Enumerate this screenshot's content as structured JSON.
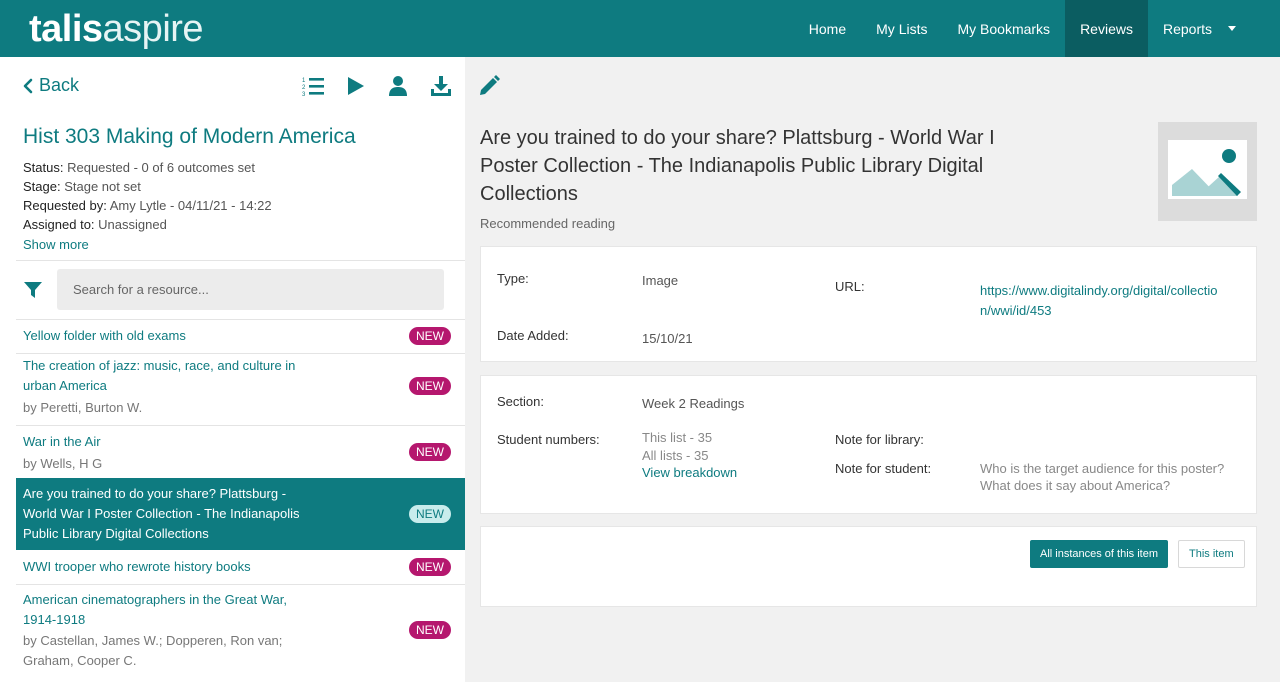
{
  "brand": {
    "logo_bold": "talis",
    "logo_light": "aspire"
  },
  "nav": {
    "items": [
      {
        "label": "Home"
      },
      {
        "label": "My Lists"
      },
      {
        "label": "My Bookmarks"
      },
      {
        "label": "Reviews"
      },
      {
        "label": "Reports"
      }
    ],
    "active": "Reviews"
  },
  "toolbar": {
    "back_label": "Back",
    "icons": [
      "numbered-list-icon",
      "play-icon",
      "user-icon",
      "download-icon",
      "pencil-icon"
    ]
  },
  "list": {
    "title": "Hist 303 Making of Modern America",
    "status_label": "Status:",
    "status_value": "Requested - 0 of 6 outcomes set",
    "stage_label": "Stage:",
    "stage_value": "Stage not set",
    "requested_label": "Requested by:",
    "requested_value": "Amy Lytle - 04/11/21 - 14:22",
    "assigned_label": "Assigned to:",
    "assigned_value": "Unassigned",
    "show_more": "Show more"
  },
  "search": {
    "placeholder": "Search for a resource..."
  },
  "resources": [
    {
      "title": "Yellow folder with old exams",
      "author": "",
      "badge": "NEW"
    },
    {
      "title_lines": [
        "The creation of jazz: music, race, and culture in",
        "urban America"
      ],
      "author": "by Peretti, Burton W.",
      "badge": "NEW"
    },
    {
      "title": "War in the Air",
      "author": "by Wells, H G",
      "badge": "NEW"
    },
    {
      "title_lines": [
        "Are you trained to do your share? Plattsburg -",
        "World War I Poster Collection - The Indianapolis",
        "Public Library Digital Collections"
      ],
      "author": "",
      "badge": "NEW"
    },
    {
      "title": "WWI trooper who rewrote history books",
      "author": "",
      "badge": "NEW"
    },
    {
      "title_lines": [
        "American cinematographers in the Great War,",
        "1914-1918"
      ],
      "author_lines": [
        "by Castellan, James W.; Dopperen, Ron van;",
        "Graham, Cooper C."
      ],
      "badge": "NEW"
    }
  ],
  "detail": {
    "title_lines": [
      "Are you trained to do your share? Plattsburg - World War I",
      "Poster Collection - The Indianapolis Public Library Digital",
      "Collections"
    ],
    "subtitle": "Recommended reading",
    "type_label": "Type:",
    "type_value": "Image",
    "url_label": "URL:",
    "url_lines": [
      "https://www.digitalindy.org/digital/collectio",
      "n/wwi/id/453"
    ],
    "date_label": "Date Added:",
    "date_value": "15/10/21",
    "section_label": "Section:",
    "section_value": "Week 2 Readings",
    "students_label": "Student numbers:",
    "this_list": "This list - 35",
    "all_lists": "All lists - 35",
    "view_breakdown": "View breakdown",
    "note_library_label": "Note for library:",
    "note_student_label": "Note for student:",
    "note_student_lines": [
      "Who is the target audience for this poster?",
      "What does it say about America?"
    ],
    "btn_all": "All instances of this item",
    "btn_this": "This item"
  },
  "colors": {
    "accent": "#0e7b80",
    "nav_active": "#0b5d61",
    "badge": "#b5176e"
  }
}
